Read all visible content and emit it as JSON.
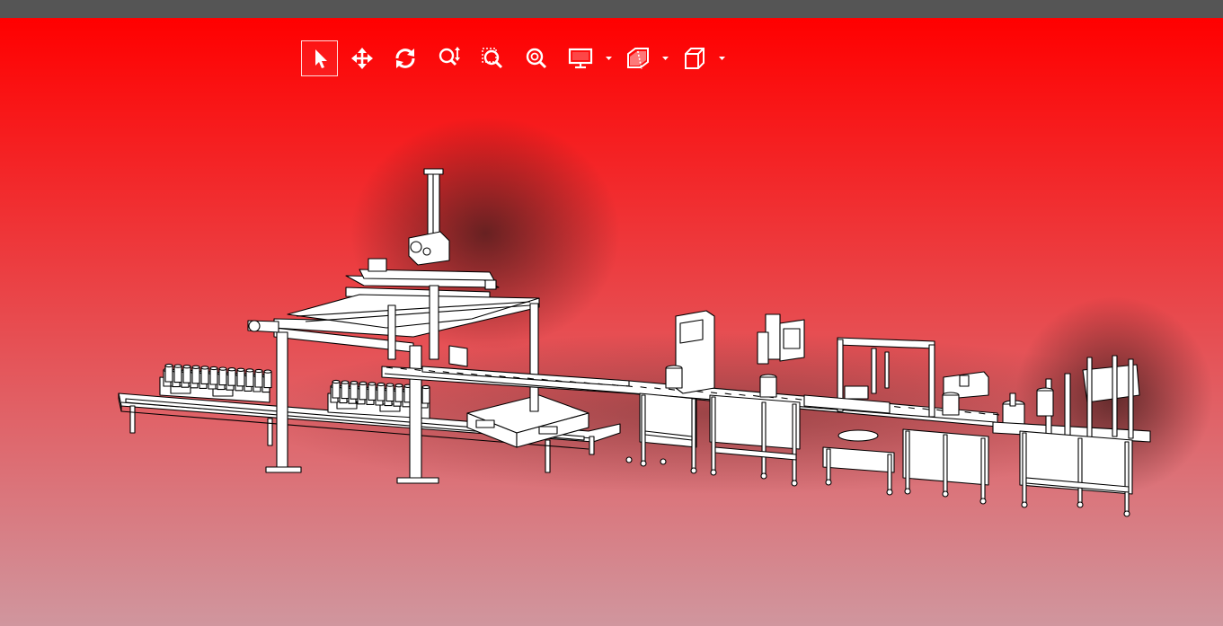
{
  "app": {
    "titlebar_color": "#555555"
  },
  "viewport": {
    "background_top": "#ff0000",
    "background_bottom": "#d0969e",
    "shadow_color": "#3a1a1a"
  },
  "toolbar": {
    "tools": [
      {
        "id": "select",
        "icon": "select-arrow-icon",
        "active": true
      },
      {
        "id": "pan",
        "icon": "pan-move-icon",
        "active": false
      },
      {
        "id": "rotate",
        "icon": "rotate-icon",
        "active": false
      },
      {
        "id": "zoom",
        "icon": "zoom-icon",
        "active": false
      },
      {
        "id": "zoom-window",
        "icon": "zoom-window-icon",
        "active": false
      },
      {
        "id": "zoom-fit",
        "icon": "zoom-fit-icon",
        "active": false
      },
      {
        "id": "display",
        "icon": "display-mode-icon",
        "has_menu": true
      },
      {
        "id": "section",
        "icon": "section-view-icon",
        "has_menu": true
      },
      {
        "id": "view-cube",
        "icon": "view-orientation-icon",
        "has_menu": true
      }
    ],
    "icon_color": "#ffffff"
  },
  "model": {
    "line_color": "#000000",
    "fill_color": "#ffffff"
  }
}
